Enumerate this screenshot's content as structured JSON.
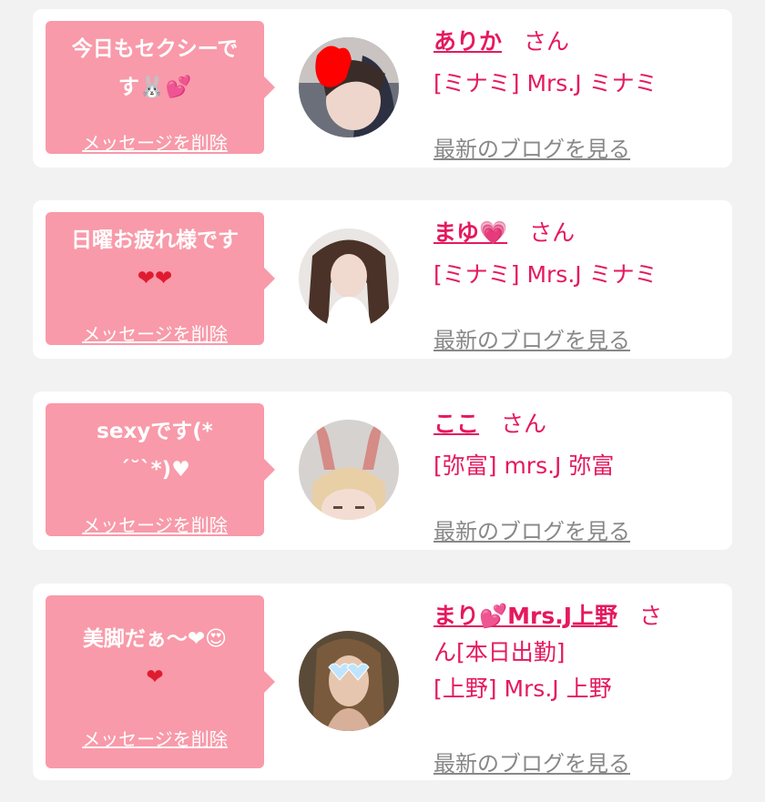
{
  "cards": [
    {
      "message_line1": "今日もセクシーで",
      "message_line2": "す🐰💕",
      "delete_label": "メッセージを削除",
      "name": "ありか",
      "san": "さん",
      "shop": "[ミナミ] Mrs.J ミナミ",
      "blog_label": "最新のブログを見る"
    },
    {
      "message_line1": "日曜お疲れ様です",
      "message_line2": "❤❤",
      "delete_label": "メッセージを削除",
      "name": "まゆ💗",
      "san": "さん",
      "shop": "[ミナミ] Mrs.J ミナミ",
      "blog_label": "最新のブログを見る"
    },
    {
      "message_line1": "sexyです(*",
      "message_line2": "´˘`*)♥",
      "delete_label": "メッセージを削除",
      "name": "ここ",
      "san": "さん",
      "shop": "[弥富] mrs.J 弥富",
      "blog_label": "最新のブログを見る"
    },
    {
      "message_line1": "美脚だぁ〜❤😍",
      "message_line2": "❤",
      "delete_label": "メッセージを削除",
      "name": "まり💕Mrs.J上野",
      "san": "さ",
      "name_line2": "ん[本日出勤]",
      "shop": "[上野] Mrs.J 上野",
      "blog_label": "最新のブログを見る"
    }
  ],
  "colors": {
    "background": "#f2f2f2",
    "bubble": "#f89aa9",
    "accent": "#e5195e",
    "link_gray": "#888888"
  }
}
